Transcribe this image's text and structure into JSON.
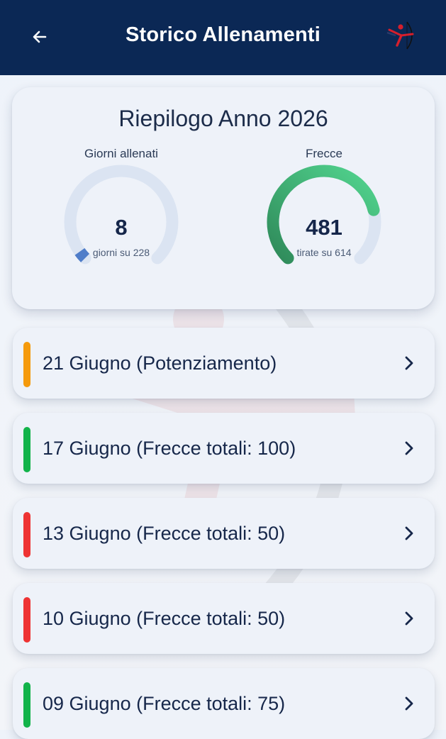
{
  "header": {
    "title": "Storico Allenamenti",
    "back_icon": "arrow-left-icon",
    "logo_icon": "archer-logo-icon"
  },
  "summary": {
    "title": "Riepilogo Anno 2026",
    "days": {
      "label": "Giorni allenati",
      "value": "8",
      "sub": "giorni su 228",
      "fraction": 0.035,
      "color": "#4f7dc9"
    },
    "arrows": {
      "label": "Frecce",
      "value": "481",
      "sub": "tirate su 614",
      "fraction": 0.783,
      "color": "#3fbf78"
    }
  },
  "sessions": [
    {
      "label": "21 Giugno (Potenziamento)",
      "color": "#f59a0c"
    },
    {
      "label": "17 Giugno (Frecce totali: 100)",
      "color": "#12b34a"
    },
    {
      "label": "13 Giugno (Frecce totali: 50)",
      "color": "#ee3333"
    },
    {
      "label": "10 Giugno (Frecce totali: 50)",
      "color": "#ee3333"
    },
    {
      "label": "09 Giugno (Frecce totali: 75)",
      "color": "#12b34a"
    }
  ]
}
